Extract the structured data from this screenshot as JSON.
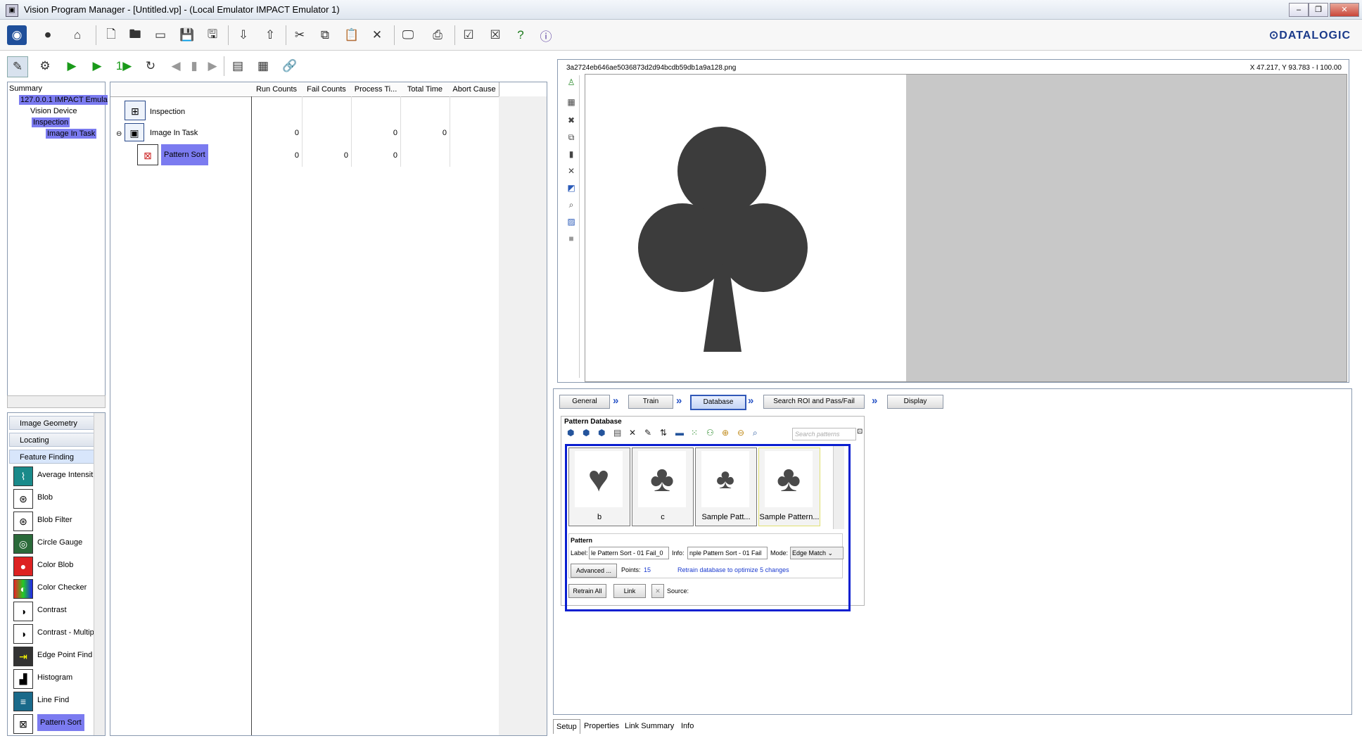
{
  "window": {
    "title": "Vision Program Manager - [Untitled.vp] - (Local Emulator IMPACT Emulator 1)",
    "minimize": "–",
    "restore": "❐",
    "close": "✕"
  },
  "brand": "⊙DATALOGIC",
  "toolbar_icons": [
    "camera-icon",
    "stop-icon",
    "home-icon",
    "new-file-icon",
    "open-icon",
    "folder-icon",
    "save-icon",
    "save-as-icon",
    "import-icon",
    "export-icon",
    "cut-icon",
    "copy-icon",
    "paste-icon",
    "delete-icon",
    "monitor-icon",
    "print-icon",
    "check-icon",
    "check-pending-icon",
    "help-icon",
    "info-icon"
  ],
  "tree": {
    "items": [
      "Summary",
      "127.0.0.1 IMPACT Emula",
      "Vision Device",
      "Inspection",
      "Image In Task"
    ]
  },
  "tool_categories": [
    "Image Geometry",
    "Locating",
    "Feature Finding"
  ],
  "tools": [
    "Average Intensit",
    "Blob",
    "Blob Filter",
    "Circle Gauge",
    "Color Blob",
    "Color Checker",
    "Contrast",
    "Contrast - Multip",
    "Edge Point Find",
    "Histogram",
    "Line Find",
    "Pattern Sort"
  ],
  "grid": {
    "columns": [
      "Run Counts",
      "Fail Counts",
      "Process Ti...",
      "Total Time",
      "Abort Cause"
    ],
    "rows": [
      {
        "name": "Inspection",
        "run": "",
        "fail": "",
        "process": "",
        "total": ""
      },
      {
        "name": "Image In Task",
        "run": "0",
        "fail": "",
        "process": "0",
        "total": "0"
      },
      {
        "name": "Pattern Sort",
        "run": "0",
        "fail": "0",
        "process": "0",
        "total": ""
      }
    ]
  },
  "image": {
    "filename": "3a2724eb646ae5036873d2d94bcdb59db1a9a128.png",
    "coords": "X 47.217,  Y 93.783  -  I 100.00",
    "symbol": "♣"
  },
  "steps": [
    "General",
    "Train",
    "Database",
    "Search ROI and Pass/Fail",
    "Display"
  ],
  "pattern_db": {
    "title": "Pattern Database",
    "search_placeholder": "Search patterns",
    "thumbs": [
      {
        "label": "b",
        "symbol": "♥"
      },
      {
        "label": "c",
        "symbol": "♣"
      },
      {
        "label": "Sample Patt...",
        "symbol": "♣"
      },
      {
        "label": "Sample Pattern...",
        "symbol": "♣"
      }
    ],
    "pattern": {
      "title": "Pattern",
      "label_caption": "Label:",
      "label_value": "le Pattern Sort - 01 Fail_0",
      "info_caption": "Info:",
      "info_value": "nple Pattern Sort - 01 Fail",
      "mode_caption": "Mode:",
      "mode_value": "Edge Match",
      "advanced": "Advanced ...",
      "points_caption": "Points:",
      "points_value": "15",
      "retrain_msg": "Retrain database to optimize 5 changes"
    },
    "retrain_all": "Retrain All",
    "link": "Link",
    "source_caption": "Source:"
  },
  "bottom_tabs": [
    "Setup",
    "Properties",
    "Link Summary",
    "Info"
  ]
}
